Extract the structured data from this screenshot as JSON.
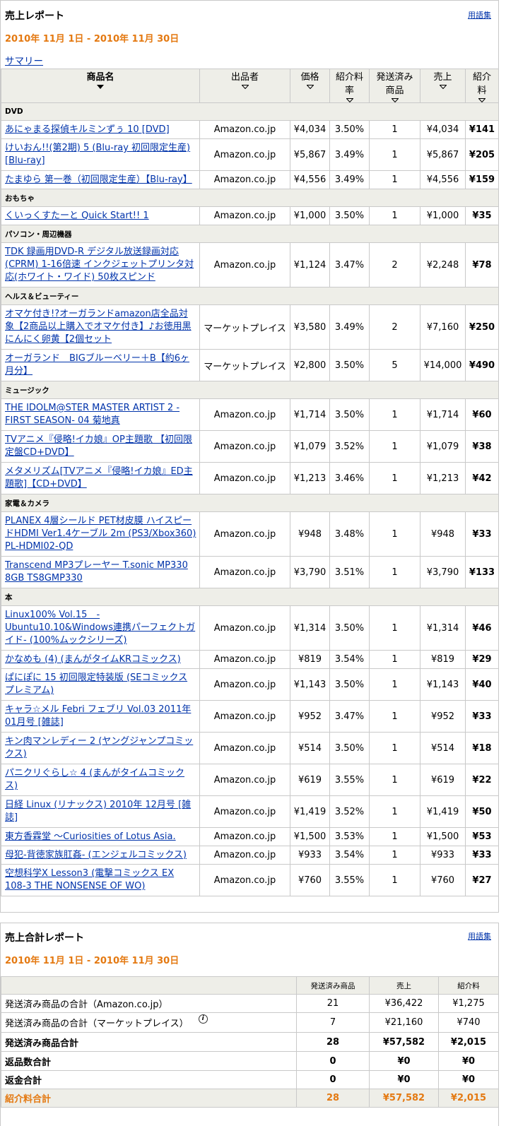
{
  "sales_report": {
    "title": "売上レポート",
    "glossary": "用語集",
    "date_range": "2010年 11月 1日 - 2010年 11月 30日",
    "summary_link": "サマリー",
    "columns": [
      "商品名",
      "出品者",
      "価格",
      "紹介料率",
      "発送済み商品",
      "売上",
      "紹介料"
    ],
    "categories": [
      {
        "name": "DVD",
        "rows": [
          {
            "name": "あにゃまる探偵キルミンずぅ 10 [DVD]",
            "seller": "Amazon.co.jp",
            "price": "¥4,034",
            "rate": "3.50%",
            "shipped": "1",
            "sales": "¥4,034",
            "fee": "¥141"
          },
          {
            "name": "けいおん!!(第2期) 5 (Blu-ray 初回限定生産) [Blu-ray]",
            "seller": "Amazon.co.jp",
            "price": "¥5,867",
            "rate": "3.49%",
            "shipped": "1",
            "sales": "¥5,867",
            "fee": "¥205"
          },
          {
            "name": "たまゆら 第一巻（初回限定生産）【Blu-ray】",
            "seller": "Amazon.co.jp",
            "price": "¥4,556",
            "rate": "3.49%",
            "shipped": "1",
            "sales": "¥4,556",
            "fee": "¥159"
          }
        ]
      },
      {
        "name": "おもちゃ",
        "rows": [
          {
            "name": "くいっくすたーと Quick Start!! 1",
            "seller": "Amazon.co.jp",
            "price": "¥1,000",
            "rate": "3.50%",
            "shipped": "1",
            "sales": "¥1,000",
            "fee": "¥35"
          }
        ]
      },
      {
        "name": "パソコン・周辺機器",
        "rows": [
          {
            "name": "TDK 録画用DVD-R デジタル放送録画対応(CPRM) 1-16倍速 インクジェットプリンタ対応(ホワイト・ワイド) 50枚スピンド",
            "seller": "Amazon.co.jp",
            "price": "¥1,124",
            "rate": "3.47%",
            "shipped": "2",
            "sales": "¥2,248",
            "fee": "¥78"
          }
        ]
      },
      {
        "name": "ヘルス＆ビューティー",
        "rows": [
          {
            "name": "オマケ付き!?オーガランドamazon店全品対象【2商品以上購入でオマケ付き】♪お徳用黒にんにく卵黄【2個セット",
            "seller": "マーケットプレイス",
            "price": "¥3,580",
            "rate": "3.49%",
            "shipped": "2",
            "sales": "¥7,160",
            "fee": "¥250"
          },
          {
            "name": "オーガランド　BIGブルーベリー＋B【約6ヶ月分】",
            "seller": "マーケットプレイス",
            "price": "¥2,800",
            "rate": "3.50%",
            "shipped": "5",
            "sales": "¥14,000",
            "fee": "¥490"
          }
        ]
      },
      {
        "name": "ミュージック",
        "rows": [
          {
            "name": "THE IDOLM@STER MASTER ARTIST 2 -FIRST SEASON- 04 菊地真",
            "seller": "Amazon.co.jp",
            "price": "¥1,714",
            "rate": "3.50%",
            "shipped": "1",
            "sales": "¥1,714",
            "fee": "¥60"
          },
          {
            "name": "TVアニメ『侵略!イカ娘』OP主題歌 【初回限定盤CD+DVD】",
            "seller": "Amazon.co.jp",
            "price": "¥1,079",
            "rate": "3.52%",
            "shipped": "1",
            "sales": "¥1,079",
            "fee": "¥38"
          },
          {
            "name": "メタメリズム[TVアニメ『侵略!イカ娘』ED主題歌]【CD+DVD】",
            "seller": "Amazon.co.jp",
            "price": "¥1,213",
            "rate": "3.46%",
            "shipped": "1",
            "sales": "¥1,213",
            "fee": "¥42"
          }
        ]
      },
      {
        "name": "家電＆カメラ",
        "rows": [
          {
            "name": "PLANEX 4層シールド PET材皮膜 ハイスピードHDMI Ver1.4ケーブル 2m (PS3/Xbox360) PL-HDMI02-QD",
            "seller": "Amazon.co.jp",
            "price": "¥948",
            "rate": "3.48%",
            "shipped": "1",
            "sales": "¥948",
            "fee": "¥33"
          },
          {
            "name": "Transcend MP3プレーヤー T.sonic MP330 8GB TS8GMP330",
            "seller": "Amazon.co.jp",
            "price": "¥3,790",
            "rate": "3.51%",
            "shipped": "1",
            "sales": "¥3,790",
            "fee": "¥133"
          }
        ]
      },
      {
        "name": "本",
        "rows": [
          {
            "name": "Linux100% Vol.15　-Ubuntu10.10&Windows連携パーフェクトガイド- (100%ムックシリーズ)",
            "seller": "Amazon.co.jp",
            "price": "¥1,314",
            "rate": "3.50%",
            "shipped": "1",
            "sales": "¥1,314",
            "fee": "¥46"
          },
          {
            "name": "かなめも (4) (まんがタイムKRコミックス)",
            "seller": "Amazon.co.jp",
            "price": "¥819",
            "rate": "3.54%",
            "shipped": "1",
            "sales": "¥819",
            "fee": "¥29"
          },
          {
            "name": "ぱにぽに 15 初回限定特装版 (SEコミックスプレミアム)",
            "seller": "Amazon.co.jp",
            "price": "¥1,143",
            "rate": "3.50%",
            "shipped": "1",
            "sales": "¥1,143",
            "fee": "¥40"
          },
          {
            "name": "キャラ☆メル Febri フェブリ Vol.03 2011年 01月号 [雑誌]",
            "seller": "Amazon.co.jp",
            "price": "¥952",
            "rate": "3.47%",
            "shipped": "1",
            "sales": "¥952",
            "fee": "¥33"
          },
          {
            "name": "キン肉マンレディー 2 (ヤングジャンプコミックス)",
            "seller": "Amazon.co.jp",
            "price": "¥514",
            "rate": "3.50%",
            "shipped": "1",
            "sales": "¥514",
            "fee": "¥18"
          },
          {
            "name": "パニクリぐらし☆ 4 (まんがタイムコミックス)",
            "seller": "Amazon.co.jp",
            "price": "¥619",
            "rate": "3.55%",
            "shipped": "1",
            "sales": "¥619",
            "fee": "¥22"
          },
          {
            "name": "日経 Linux (リナックス) 2010年 12月号 [雑誌]",
            "seller": "Amazon.co.jp",
            "price": "¥1,419",
            "rate": "3.52%",
            "shipped": "1",
            "sales": "¥1,419",
            "fee": "¥50"
          },
          {
            "name": "東方香霖堂 ～Curiosities of Lotus Asia.",
            "seller": "Amazon.co.jp",
            "price": "¥1,500",
            "rate": "3.53%",
            "shipped": "1",
            "sales": "¥1,500",
            "fee": "¥53"
          },
          {
            "name": "母犯-背徳家族肛姦- (エンジェルコミックス)",
            "seller": "Amazon.co.jp",
            "price": "¥933",
            "rate": "3.54%",
            "shipped": "1",
            "sales": "¥933",
            "fee": "¥33"
          },
          {
            "name": "空想科学X Lesson3 (電撃コミックス EX 108-3 THE NONSENSE OF WO)",
            "seller": "Amazon.co.jp",
            "price": "¥760",
            "rate": "3.55%",
            "shipped": "1",
            "sales": "¥760",
            "fee": "¥27"
          }
        ]
      }
    ]
  },
  "totals_report": {
    "title": "売上合計レポート",
    "glossary": "用語集",
    "date_range": "2010年 11月 1日 - 2010年 11月 30日",
    "columns": [
      "",
      "発送済み商品",
      "売上",
      "紹介料"
    ],
    "rows": [
      {
        "label": "発送済み商品の合計（Amazon.co.jp）",
        "shipped": "21",
        "sales": "¥36,422",
        "fee": "¥1,275",
        "style": "normal",
        "info": false
      },
      {
        "label": "発送済み商品の合計（マーケットプレイス）",
        "shipped": "7",
        "sales": "¥21,160",
        "fee": "¥740",
        "style": "normal",
        "info": true
      },
      {
        "label": "発送済み商品合計",
        "shipped": "28",
        "sales": "¥57,582",
        "fee": "¥2,015",
        "style": "bold",
        "info": false
      },
      {
        "label": "返品数合計",
        "shipped": "0",
        "sales": "¥0",
        "fee": "¥0",
        "style": "bold",
        "info": false
      },
      {
        "label": "返金合計",
        "shipped": "0",
        "sales": "¥0",
        "fee": "¥0",
        "style": "bold",
        "info": false
      },
      {
        "label": "紹介料合計",
        "shipped": "28",
        "sales": "¥57,582",
        "fee": "¥2,015",
        "style": "fee",
        "info": false
      }
    ]
  },
  "accent_color": "#e47911",
  "link_color": "#0033aa"
}
